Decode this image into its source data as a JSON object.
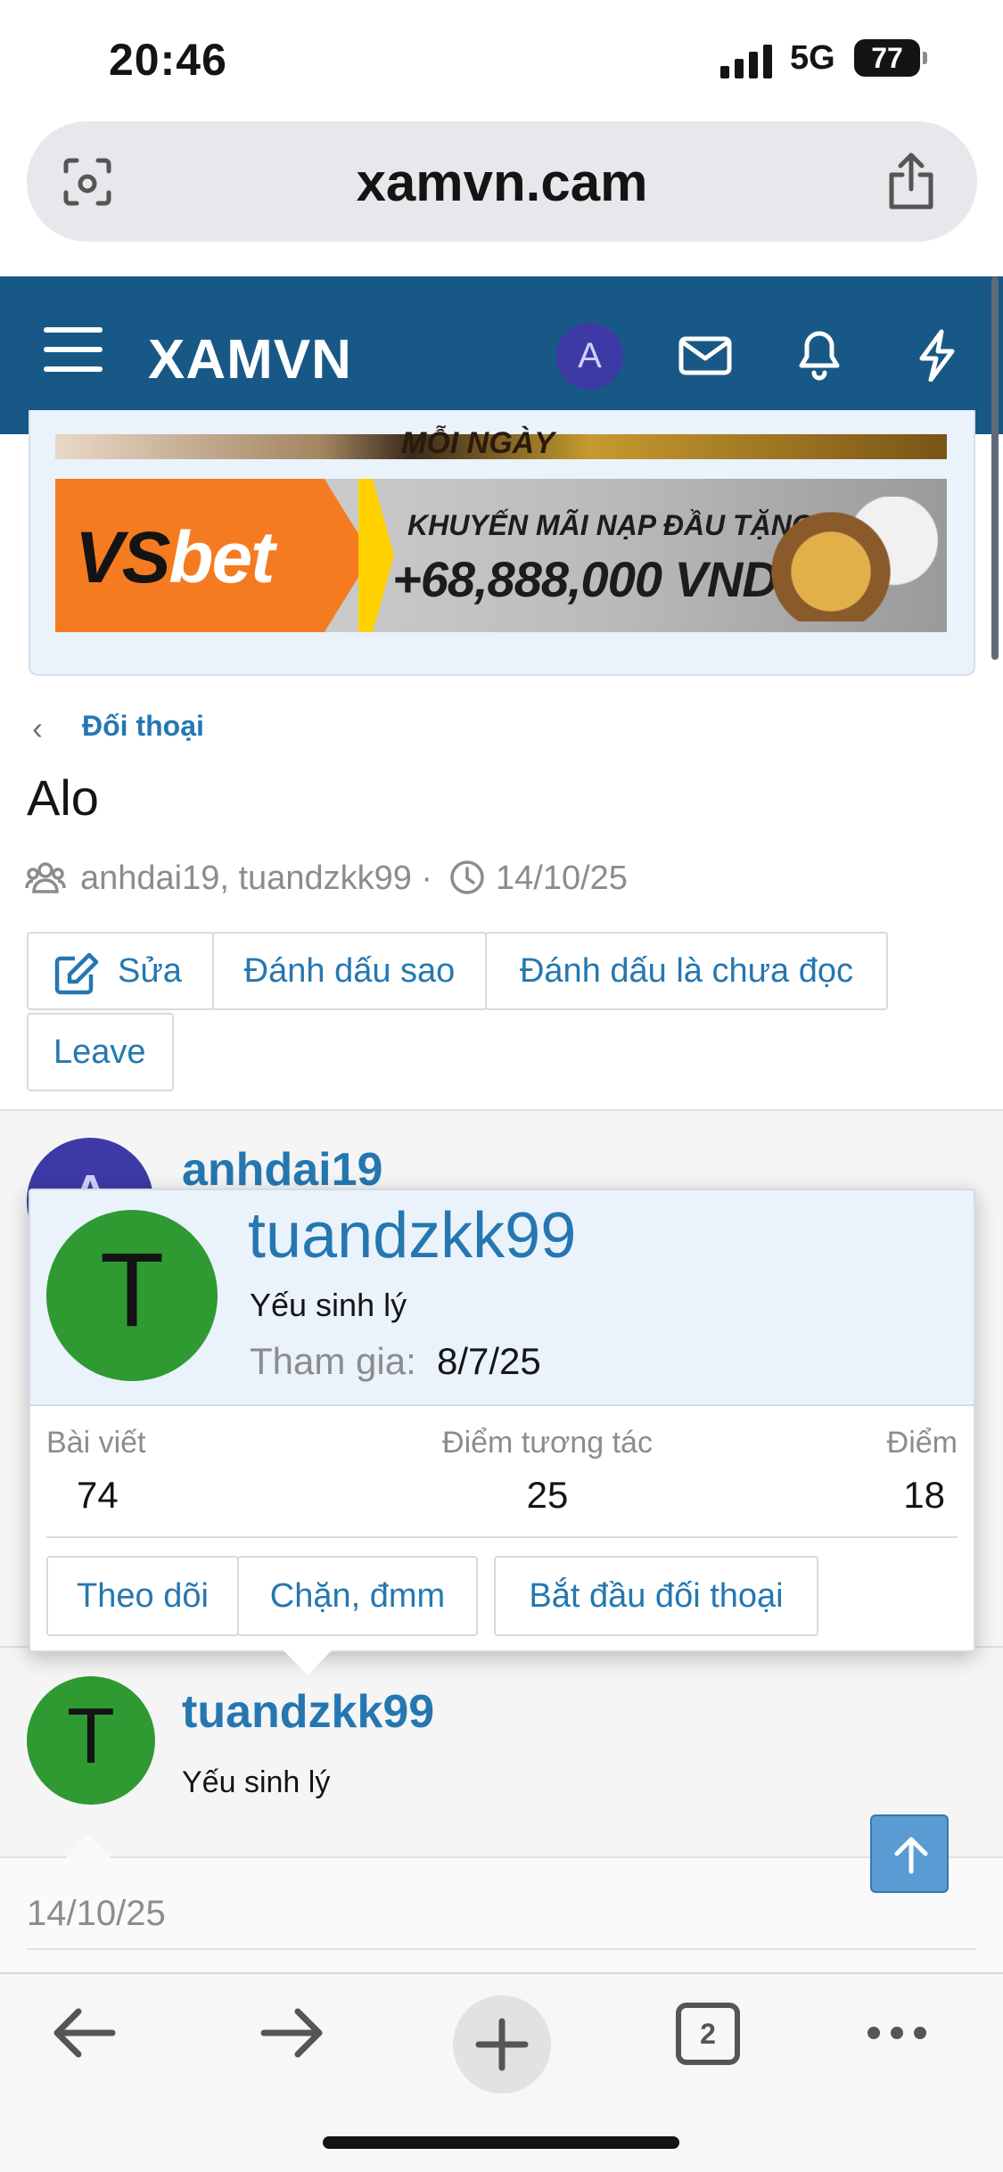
{
  "status_bar": {
    "time": "20:46",
    "network": "5G",
    "battery": "77"
  },
  "browser": {
    "url": "xamvn.cam",
    "tab_count": "2"
  },
  "site": {
    "logo": "XAMVN",
    "user_initial": "A"
  },
  "banners": {
    "top_text": "MỖI NGÀY",
    "vsbet_logo_a": "VS",
    "vsbet_logo_b": "bet",
    "promo_line1": "KHUYẾN MÃI NẠP ĐẦU TẶNG",
    "promo_line2": "+68,888,000 VND"
  },
  "breadcrumb": {
    "label": "Đối thoại"
  },
  "conversation": {
    "title": "Alo",
    "participants": "anhdai19, tuandzkk99 ·",
    "date": "14/10/25"
  },
  "actions": {
    "edit": "Sửa",
    "star": "Đánh dấu sao",
    "mark_unread": "Đánh dấu là chưa đọc",
    "leave": "Leave"
  },
  "messages": [
    {
      "initial": "A",
      "author": "anhdai19"
    },
    {
      "initial": "T",
      "author": "tuandzkk99",
      "rank": "Yếu sinh lý",
      "date": "14/10/25"
    }
  ],
  "popup": {
    "initial": "T",
    "name": "tuandzkk99",
    "rank": "Yếu sinh lý",
    "joined_label": "Tham gia:",
    "joined_value": "8/7/25",
    "stats": [
      {
        "label": "Bài viết",
        "value": "74"
      },
      {
        "label": "Điểm tương tác",
        "value": "25"
      },
      {
        "label": "Điểm",
        "value": "18"
      }
    ],
    "buttons": {
      "follow": "Theo dõi",
      "block": "Chặn, đmm",
      "start_conversation": "Bắt đầu đối thoại"
    }
  },
  "colors": {
    "header": "#185886",
    "link": "#2577b1",
    "avatar_a": "#3e3aa5",
    "avatar_t": "#2f9a32"
  }
}
